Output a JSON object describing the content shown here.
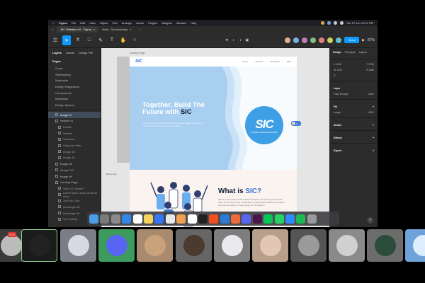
{
  "menubar": {
    "app": "Figma",
    "items": [
      "File",
      "Edit",
      "View",
      "Object",
      "Text",
      "Arrange",
      "Vector",
      "Plugins",
      "Widgets",
      "Window",
      "Help"
    ],
    "clock": "Tue 27 Jun 10:37 PM"
  },
  "tabs": [
    {
      "label": "SIC Website 4.0 - Figma"
    },
    {
      "label": "Meet - Scrumstartup"
    }
  ],
  "toolbar": {
    "share_label": "Share",
    "zoom": "87%"
  },
  "left_panel": {
    "tabs": [
      "Layers",
      "Assets",
      "Design File"
    ],
    "pages_header": "Pages",
    "pages": [
      "Cover",
      "Wireframing",
      "Illustration",
      "Design Playground",
      "Components",
      "Illustration",
      "Design System"
    ],
    "layers": [
      {
        "label": "Image 67",
        "selected": true,
        "sub": false
      },
      {
        "label": "Header v1",
        "selected": false,
        "sub": false
      },
      {
        "label": "Divider",
        "selected": false,
        "sub": true
      },
      {
        "label": "Navbar",
        "selected": false,
        "sub": true
      },
      {
        "label": "Shadows",
        "selected": false,
        "sub": true
      },
      {
        "label": "Shadows New",
        "selected": false,
        "sub": true
      },
      {
        "label": "Image 48",
        "selected": false,
        "sub": true
      },
      {
        "label": "Image 49",
        "selected": false,
        "sub": true
      },
      {
        "label": "Image 68",
        "selected": false,
        "sub": false
      },
      {
        "label": "Group 214",
        "selected": false,
        "sub": false
      },
      {
        "label": "Image 69",
        "selected": false,
        "sub": false
      },
      {
        "label": "Landing Page",
        "selected": false,
        "sub": false
      },
      {
        "label": "Why SIC Exists?",
        "selected": false,
        "sub": true
      },
      {
        "label": "Lorem ipsum dolor sit amet cons...",
        "selected": false,
        "sub": true
      },
      {
        "label": "Join the Club",
        "selected": false,
        "sub": true
      },
      {
        "label": "Rectangle 45",
        "selected": false,
        "sub": true
      },
      {
        "label": "Rectangle 44",
        "selected": false,
        "sub": true
      },
      {
        "label": "SIC Activity",
        "selected": false,
        "sub": true
      }
    ]
  },
  "canvas": {
    "frame_label": "Landing Page",
    "side_label": "Mobile view",
    "nav_logo": "SIC",
    "nav_links": [
      "Home",
      "Timeline",
      "SIC Dates",
      "Blog"
    ],
    "hero_title_prefix": "Together, Build The Future with ",
    "hero_title_highlight": "SIC",
    "hero_subtitle": "Connecting student communities to innovate together, building a better world with our community initiatives.",
    "circle_logo": "SIC",
    "circle_tagline": "STUDENT INNOVATION CENTRE",
    "what_prefix": "What is ",
    "what_highlight": "SIC?",
    "what_body": "SIC is a community of like-minded students and industry people who strive to develop strong knowledge by collaborating between members who have a passion in technology and innovation."
  },
  "right_panel": {
    "tabs": [
      "Design",
      "Prototype",
      "Inspect"
    ],
    "x": "8106",
    "y": "2750",
    "w": "1920",
    "h": "1080",
    "rotation": "0°",
    "layer_header": "Layer",
    "pass_through": "Pass through",
    "opacity": "100%",
    "fill_header": "Fill",
    "fill_label": "Image",
    "fill_opacity": "100%",
    "stroke_header": "Stroke",
    "effects_header": "Effects",
    "export_header": "Export"
  },
  "dock_icons": [
    "finder",
    "launchpad",
    "settings",
    "safari",
    "calendar",
    "notes",
    "appstore",
    "chrome",
    "photos",
    "notion",
    "terminal",
    "figma",
    "vscode",
    "postman",
    "discord",
    "slack",
    "line",
    "whatsapp",
    "zoom",
    "spotify",
    "trash"
  ],
  "participants": [
    {
      "name": "participant-1",
      "bg": "#3a3a3a",
      "avatar": "#bbb"
    },
    {
      "name": "participant-2",
      "bg": "#1b1b1b",
      "avatar": "#222"
    },
    {
      "name": "participant-3",
      "bg": "#7b7e86",
      "avatar": "#d9d9e3"
    },
    {
      "name": "participant-4",
      "bg": "#3d9b5e",
      "avatar": "#5865f2"
    },
    {
      "name": "participant-5",
      "bg": "#a88b6e",
      "avatar": "#c9a27a"
    },
    {
      "name": "participant-6",
      "bg": "#666",
      "avatar": "#4a3a30"
    },
    {
      "name": "participant-7",
      "bg": "#7d7d7d",
      "avatar": "#e9e9ee"
    },
    {
      "name": "participant-8",
      "bg": "#b89f8c",
      "avatar": "#e3c7b2"
    },
    {
      "name": "participant-9",
      "bg": "#555",
      "avatar": "#9a9a9a"
    },
    {
      "name": "participant-10",
      "bg": "#8a8a8a",
      "avatar": "#d0d0d0"
    },
    {
      "name": "participant-11",
      "bg": "#6c6c6c",
      "avatar": "#2b4b3b"
    },
    {
      "name": "participant-12",
      "bg": "#6fa2d8",
      "avatar": "#dfeeff"
    }
  ],
  "recording_badge": "0:00",
  "colors": {
    "figma_blue": "#0d99ff",
    "sic_blue": "#2f6fd6",
    "hero_blue": "#a9cff0"
  }
}
